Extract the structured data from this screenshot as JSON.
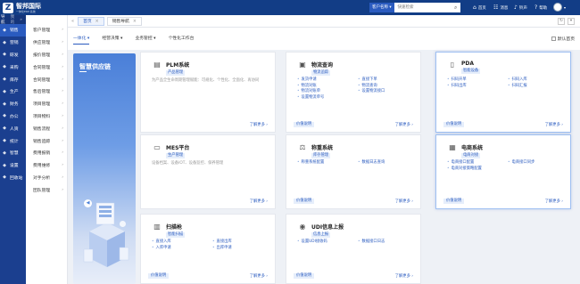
{
  "header": {
    "logo_mark": "Z",
    "logo_name": "智邦国际",
    "logo_sub": "一体化ERP·系统",
    "search_select": "客户名称 ▾",
    "search_placeholder": "快速检索",
    "search_icon": "search-icon",
    "nav": [
      {
        "icon": "home-icon",
        "glyph": "⌂",
        "label": "首页"
      },
      {
        "icon": "message-icon",
        "glyph": "☷",
        "label": "消息"
      },
      {
        "icon": "bell-icon",
        "glyph": "♪",
        "label": "铃声"
      },
      {
        "icon": "help-icon",
        "glyph": "?",
        "label": "帮助"
      }
    ]
  },
  "sidebar": {
    "head": [
      "导航",
      "我的"
    ],
    "head_arrow": "»",
    "items": [
      {
        "label": "销售",
        "glyph": "◆",
        "icon": "sales-icon"
      },
      {
        "label": "营销",
        "glyph": "◆",
        "icon": "marketing-icon"
      },
      {
        "label": "研发",
        "glyph": "◆",
        "icon": "rnd-icon"
      },
      {
        "label": "采购",
        "glyph": "◆",
        "icon": "purchase-icon"
      },
      {
        "label": "库存",
        "glyph": "◆",
        "icon": "inventory-icon"
      },
      {
        "label": "生产",
        "glyph": "◆",
        "icon": "production-icon"
      },
      {
        "label": "财务",
        "glyph": "◆",
        "icon": "finance-icon"
      },
      {
        "label": "办公",
        "glyph": "◆",
        "icon": "office-icon"
      },
      {
        "label": "人资",
        "glyph": "◆",
        "icon": "hr-icon"
      },
      {
        "label": "统计",
        "glyph": "◆",
        "icon": "stats-icon"
      },
      {
        "label": "智慧",
        "glyph": "◆",
        "icon": "smart-icon"
      },
      {
        "label": "设置",
        "glyph": "◆",
        "icon": "settings-icon"
      },
      {
        "label": "回收站",
        "glyph": "◆",
        "icon": "recycle-icon"
      }
    ]
  },
  "submenu": {
    "items": [
      "客户管理",
      "供应管理",
      "报价管理",
      "合同管理",
      "合同管理",
      "售后管理",
      "项目管理",
      "项目物料",
      "销售流程",
      "销售追踪",
      "费用报销",
      "费用维修",
      "对手分析",
      "团队管理"
    ],
    "caret": "›"
  },
  "tabbar": {
    "arrow": "«",
    "tabs": [
      {
        "label": "首页",
        "active": true
      },
      {
        "label": "销售导航",
        "active": false
      }
    ],
    "close_mark": "×",
    "right_icons": [
      {
        "icon": "refresh-icon",
        "glyph": "↻"
      },
      {
        "icon": "chevron-down-icon",
        "glyph": "▾"
      }
    ]
  },
  "subtabs": [
    {
      "label": "一体化 ▾",
      "active": true
    },
    {
      "label": "经营决策 ▾",
      "active": false
    },
    {
      "label": "业务管控 ▾",
      "active": false
    },
    {
      "label": "个性化工作台",
      "active": false
    }
  ],
  "default_page": {
    "label": "默认首页",
    "checked": false
  },
  "banner": {
    "title": "智慧供应链",
    "dot": "◀"
  },
  "cards": [
    {
      "name": "PLM系统",
      "tag": "产品管理",
      "glyph": "▤",
      "icon": "plm-icon",
      "desc": "为产品全生命周期管理赋能：可规化、个性化、全面化、再协同",
      "links": [],
      "more": "了解更多",
      "pill": ""
    },
    {
      "name": "物流查询",
      "tag": "物流追踪",
      "glyph": "▣",
      "icon": "logistics-icon",
      "desc": "",
      "links": [
        "发货申请",
        "直接下单",
        "物流对账",
        "物流查询",
        "物流对账单",
        "设置物流接口",
        "设置物流单号"
      ],
      "more": "了解更多",
      "pill": "价值说明"
    },
    {
      "name": "PDA",
      "tag": "智能设备",
      "glyph": "▯",
      "icon": "pda-icon",
      "desc": "",
      "links": [
        "扫码开单",
        "扫码入库",
        "扫码出库",
        "扫码汇报"
      ],
      "more": "了解更多",
      "pill": "价值说明"
    },
    {
      "name": "MES平台",
      "tag": "生产管理",
      "glyph": "▭",
      "icon": "mes-icon",
      "desc": "设备档案、设备IOT、设备监控、保养管理",
      "links": [],
      "more": "了解更多",
      "pill": ""
    },
    {
      "name": "称重系统",
      "tag": "库存管理",
      "glyph": "⚖",
      "icon": "weigh-icon",
      "desc": "",
      "links": [
        "称重系统配置",
        "数据日志查询"
      ],
      "more": "了解更多",
      "pill": "价值说明"
    },
    {
      "name": "电商系统",
      "tag": "电商对接",
      "glyph": "▦",
      "icon": "ecommerce-icon",
      "desc": "",
      "links": [
        "电商接口配置",
        "电商接口同步",
        "电商对接策略配置"
      ],
      "more": "了解更多",
      "pill": "价值说明"
    },
    {
      "name": "扫描枪",
      "tag": "智能扫描",
      "glyph": "▥",
      "icon": "scanner-icon",
      "desc": "",
      "links": [
        "直接入库",
        "直接出库",
        "入库申请",
        "出库申请"
      ],
      "more": "了解更多",
      "pill": "价值说明"
    },
    {
      "name": "UDI信息上报",
      "tag": "信息上报",
      "glyph": "◉",
      "icon": "udi-icon",
      "desc": "",
      "links": [
        "设置UDI接收码",
        "数据接口日志"
      ],
      "more": "了解更多",
      "pill": "价值说明"
    }
  ],
  "colors": {
    "topbar": "#123d86",
    "sidebar": "#1b3f8f",
    "accent": "#2a5bbf"
  }
}
